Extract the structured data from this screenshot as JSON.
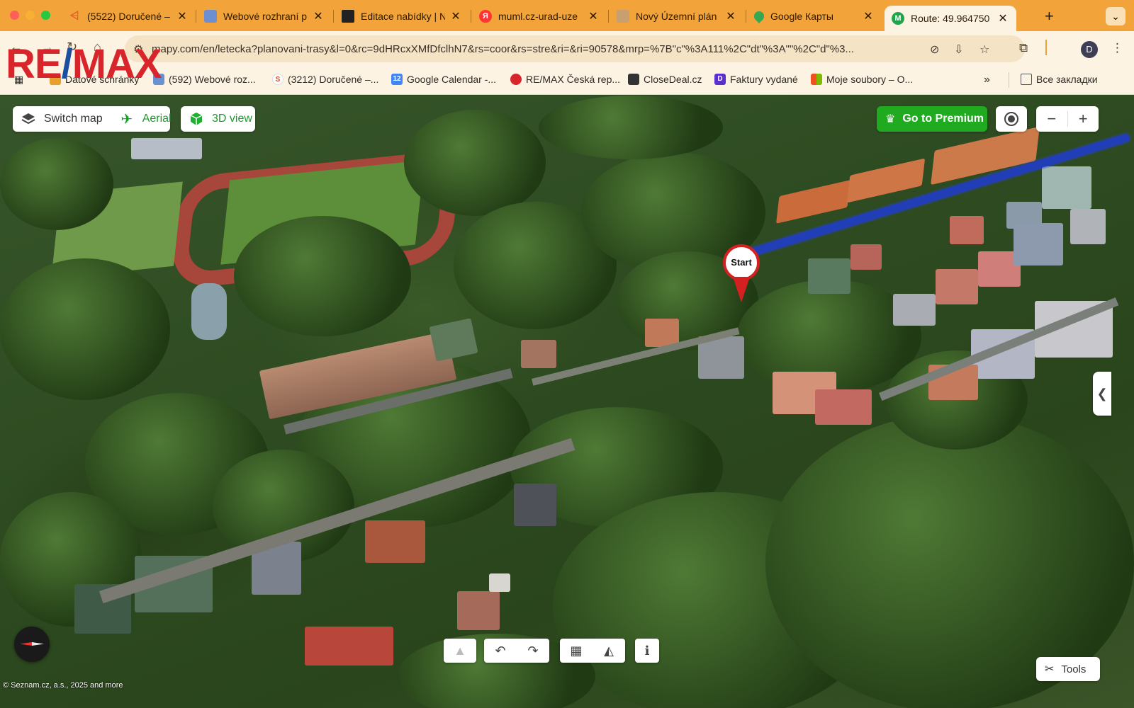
{
  "browser": {
    "tabs": [
      {
        "label": "(5522) Doručené –",
        "favicon": "mail-icon",
        "color": "#e8612c"
      },
      {
        "label": "Webové rozhraní p",
        "favicon": "cube-icon",
        "color": "#6b8fd0"
      },
      {
        "label": "Editace nabídky | N",
        "favicon": "document-icon",
        "color": "#222222"
      },
      {
        "label": "muml.cz-urad-uze",
        "favicon": "yandex-icon",
        "color": "#f33"
      },
      {
        "label": "Nový Územní plán",
        "favicon": "building-icon",
        "color": "#b89060"
      },
      {
        "label": "Google Карты",
        "favicon": "maps-pin-icon",
        "color": "#34a853"
      },
      {
        "label": "Route: 49.964750",
        "favicon": "mapy-icon",
        "color": "#1fa64a"
      }
    ],
    "url": "mapy.com/en/letecka?planovani-trasy&l=0&rc=9dHRcxXMfDfclhN7&rs=coor&rs=stre&ri=&ri=90578&mrp=%7B\"c\"%3A111%2C\"dt\"%3A\"\"%2C\"d\"%3...",
    "profile_initial": "D",
    "bookmarks": [
      {
        "label": "Datové schránky",
        "icon": "datove-icon",
        "color": "#e8a02c"
      },
      {
        "label": "(592) Webové roz...",
        "icon": "cube-icon",
        "color": "#6b8fd0"
      },
      {
        "label": "(3212) Doručené –...",
        "icon": "seznam-icon",
        "color": "#d42"
      },
      {
        "label": "Google Calendar -...",
        "icon": "calendar-icon",
        "color": "#4285f4"
      },
      {
        "label": "RE/MAX Česká rep...",
        "icon": "balloon-icon",
        "color": "#1b4fa0"
      },
      {
        "label": "CloseDeal.cz",
        "icon": "closedeal-icon",
        "color": "#333"
      },
      {
        "label": "Faktury vydané",
        "icon": "fakturoid-icon",
        "color": "#5a2fd0"
      },
      {
        "label": "Moje soubory – O...",
        "icon": "microsoft-icon",
        "color": "#f25022"
      }
    ],
    "all_bookmarks_label": "Все закладки"
  },
  "overlay_logo": {
    "left": "RE",
    "slash": "/",
    "right": "MAX"
  },
  "map": {
    "controls": {
      "switch_map": "Switch map",
      "aerial": "Aerial",
      "view_3d": "3D view",
      "premium": "Go to Premium",
      "zoom_out": "−",
      "zoom_in": "+"
    },
    "marker_label": "Start",
    "tools_label": "Tools",
    "info_label": "i",
    "copyright": "© Seznam.cz, a.s., 2025 and more",
    "colors": {
      "route": "#1f3dd1",
      "marker": "#d42020",
      "premium": "#1faa1f"
    }
  }
}
